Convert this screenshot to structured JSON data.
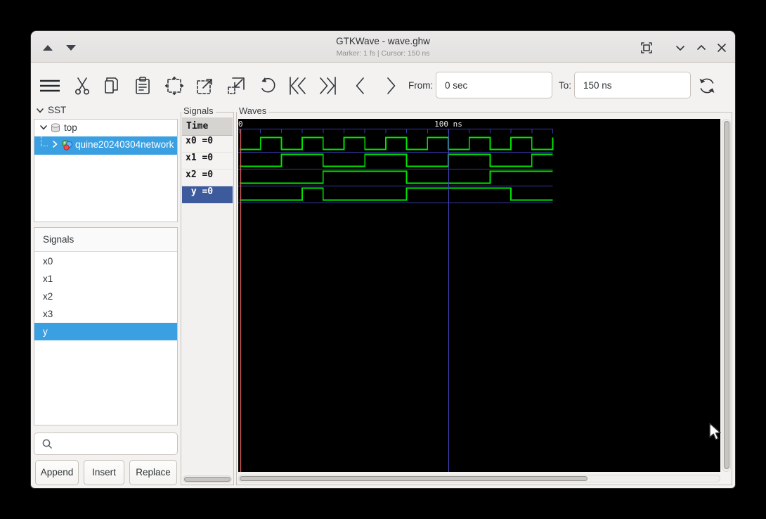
{
  "window": {
    "title": "GTKWave - wave.ghw",
    "status": "Marker: 1 fs  |  Cursor: 150 ns",
    "controls": [
      "shade-up",
      "shade-down",
      "fullscreen",
      "minimize",
      "maximize",
      "close"
    ]
  },
  "toolbar": {
    "icons": [
      "menu",
      "cut",
      "copy",
      "paste",
      "zoom-fit",
      "zoom-in",
      "zoom-out",
      "undo",
      "skip-to-start",
      "skip-to-end",
      "previous-edge",
      "next-edge",
      "reload"
    ],
    "from_label": "From:",
    "from_value": "0 sec",
    "to_label": "To:",
    "to_value": "150 ns"
  },
  "sst": {
    "header": "SST",
    "tree": [
      {
        "label": "top",
        "icon": "scope-icon",
        "expanded": true,
        "selected": false,
        "depth": 0
      },
      {
        "label": "quine20240304network",
        "icon": "module-icon",
        "expanded": false,
        "selected": true,
        "depth": 1
      }
    ]
  },
  "signal_list": {
    "frame_label": "Signals",
    "items": [
      {
        "label": "x0",
        "selected": false
      },
      {
        "label": "x1",
        "selected": false
      },
      {
        "label": "x2",
        "selected": false
      },
      {
        "label": "x3",
        "selected": false
      },
      {
        "label": "y",
        "selected": true
      }
    ]
  },
  "search": {
    "value": "",
    "icon": "search-icon"
  },
  "actions": {
    "append": "Append",
    "insert": "Insert",
    "replace": "Replace"
  },
  "signals_panel": {
    "frame_label": "Signals",
    "time_header": "Time",
    "rows": [
      {
        "label": "x0 =0",
        "selected": false
      },
      {
        "label": "x1 =0",
        "selected": false
      },
      {
        "label": "x2 =0",
        "selected": false
      },
      {
        "label": " y =0",
        "selected": true
      }
    ]
  },
  "waves": {
    "frame_label": "Waves",
    "timeline": {
      "origin_label": "0",
      "major_label": "100 ns",
      "major_at_ns": 100,
      "tick_step_ns": 10
    },
    "view_start_ns": 0,
    "view_end_ns": 150,
    "marker_ns": 0,
    "cursor_ns": 100,
    "colors": {
      "background": "#000000",
      "wave": "#00e400",
      "grid": "#3737a6",
      "marker": "#cf5f5f",
      "cursor": "#4545c2",
      "timeline_text": "#e8e8e8"
    },
    "traces": [
      {
        "name": "x0",
        "initial": 0,
        "toggles_ns": [
          10,
          20,
          30,
          40,
          50,
          60,
          70,
          80,
          90,
          100,
          110,
          120,
          130,
          140,
          150
        ]
      },
      {
        "name": "x1",
        "initial": 0,
        "toggles_ns": [
          20,
          40,
          60,
          80,
          100,
          120,
          140
        ]
      },
      {
        "name": "x2",
        "initial": 0,
        "toggles_ns": [
          40,
          80,
          120
        ]
      },
      {
        "name": "y",
        "initial": 0,
        "toggles_ns": [
          30,
          40,
          80,
          130
        ]
      }
    ]
  },
  "colors": {
    "selection_blue": "#3ba0e2",
    "selection_navy": "#3d5a9d"
  }
}
